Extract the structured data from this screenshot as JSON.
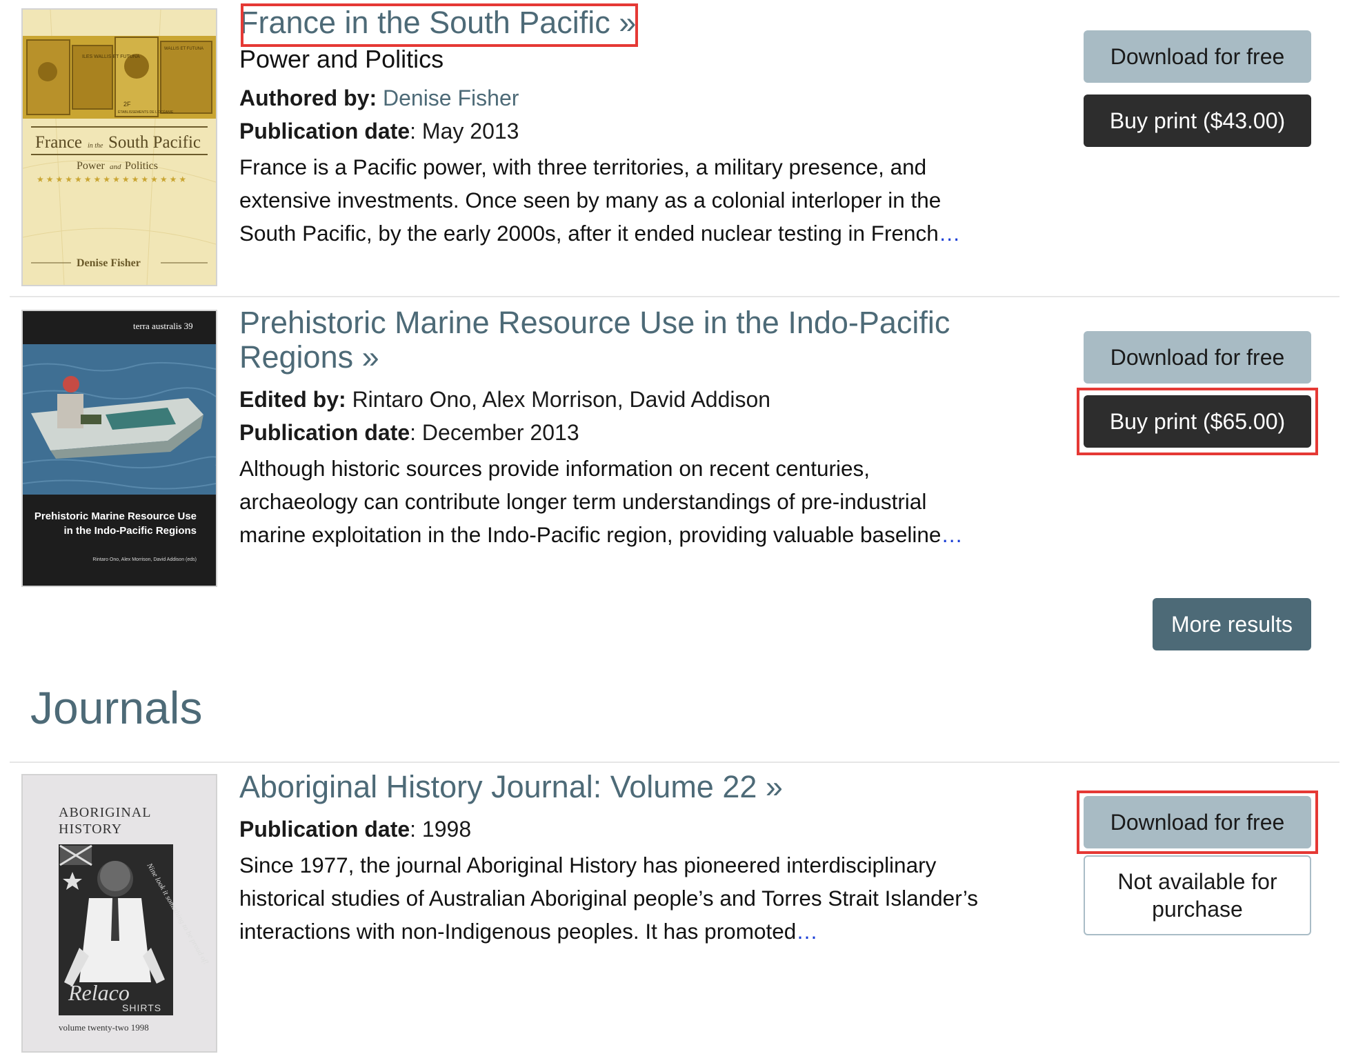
{
  "books": [
    {
      "title": "France in the South Pacific »",
      "subtitle": "Power and Politics",
      "byline_label": "Authored by:",
      "authors": "Denise Fisher",
      "pubdate_label": "Publication date",
      "pubdate": ": May 2013",
      "description": "France is a Pacific power, with three territories, a military presence, and extensive investments. Once seen by many as a colonial interloper in the South Pacific, by the early 2000s, after it ended nuclear testing in French",
      "ellipsis": "…",
      "download_label": "Download for free",
      "buy_label": "Buy print ($43.00)",
      "cover": {
        "title_main": "France",
        "title_small": "in the",
        "title_rest": "South Pacific",
        "subtitle_a": "Power",
        "subtitle_and": "and",
        "subtitle_b": "Politics",
        "author": "Denise Fisher",
        "stamp_texts": [
          "ILES WALLIS ET FUTUNA",
          "2F",
          "ÉTABLISSEMENTS DE L'OCÉANIE",
          "WALLIS ET FUTUNA"
        ]
      }
    },
    {
      "title": "Prehistoric Marine Resource Use in the Indo-Pacific Regions »",
      "byline_label": "Edited by:",
      "authors": "Rintaro Ono, Alex Morrison, David Addison",
      "pubdate_label": "Publication date",
      "pubdate": ": December 2013",
      "description": "Although historic sources provide information on recent centuries, archaeology can contribute longer term understandings of pre-industrial marine exploitation in the Indo-Pacific region, providing valuable baseline",
      "ellipsis": "…",
      "download_label": "Download for free",
      "buy_label": "Buy print ($65.00)",
      "cover": {
        "series": "terra australis 39",
        "title_line1": "Prehistoric Marine Resource Use",
        "title_line2": "in the Indo-Pacific Regions",
        "editors": "Rintaro Ono, Alex Morrison, David Addison (eds)"
      }
    }
  ],
  "more_results_label": "More results",
  "journals_heading": "Journals",
  "journals": [
    {
      "title": "Aboriginal History Journal: Volume 22 »",
      "pubdate_label": "Publication date",
      "pubdate": ": 1998",
      "description": "Since 1977, the journal Aboriginal History has pioneered interdisciplinary historical studies of Australian Aboriginal people’s and Torres Strait Islander’s interactions with non-Indigenous peoples. It has promoted",
      "ellipsis": "…",
      "download_label": "Download for free",
      "purchase_status": "Not available for purchase",
      "cover": {
        "title_line1": "ABORIGINAL",
        "title_line2": "HISTORY",
        "poster_script": "Relaco",
        "poster_shirts": "SHIRTS",
        "poster_handwriting": "Nine look it something to be proud of!",
        "volume": "volume twenty-two 1998"
      }
    }
  ],
  "colors": {
    "link": "#4d6a77",
    "download_button": "#a8bbc4",
    "buy_button": "#2d2d2d",
    "more_button": "#4d6a77",
    "highlight": "#e53935"
  }
}
